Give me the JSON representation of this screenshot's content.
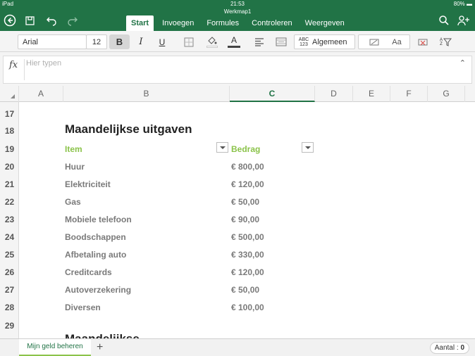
{
  "status_bar": {
    "carrier": "iPad",
    "time": "21:53",
    "battery": "80%"
  },
  "document": {
    "title": "Werkmap1"
  },
  "ribbon": {
    "tabs": [
      {
        "label": "Start"
      },
      {
        "label": "Invoegen"
      },
      {
        "label": "Formules"
      },
      {
        "label": "Controleren"
      },
      {
        "label": "Weergeven"
      }
    ]
  },
  "toolbar": {
    "font_name": "Arial",
    "font_size": "12",
    "bold_label": "B",
    "italic_label": "I",
    "underline_label": "U",
    "number_format_label": "Algemeen",
    "number_format_icon_text": "ABC 123",
    "styles_label": "Aa",
    "sort_icon_text": "A Z"
  },
  "formula_bar": {
    "fx_label": "fx",
    "placeholder": "Hier typen"
  },
  "columns": [
    "A",
    "B",
    "C",
    "D",
    "E",
    "F",
    "G"
  ],
  "selected_column": "C",
  "rows": [
    "17",
    "18",
    "19",
    "20",
    "21",
    "22",
    "23",
    "24",
    "25",
    "26",
    "27",
    "28",
    "29"
  ],
  "sheet": {
    "title": "Maandelijkse uitgaven",
    "headers": {
      "item": "Item",
      "amount": "Bedrag"
    },
    "entries": [
      {
        "item": "Huur",
        "amount": "€ 800,00"
      },
      {
        "item": "Elektriciteit",
        "amount": "€ 120,00"
      },
      {
        "item": "Gas",
        "amount": "€ 50,00"
      },
      {
        "item": "Mobiele telefoon",
        "amount": "€ 90,00"
      },
      {
        "item": "Boodschappen",
        "amount": "€ 500,00"
      },
      {
        "item": "Afbetaling auto",
        "amount": "€ 330,00"
      },
      {
        "item": "Creditcards",
        "amount": "€ 120,00"
      },
      {
        "item": "Autoverzekering",
        "amount": "€ 50,00"
      },
      {
        "item": "Diversen",
        "amount": "€ 100,00"
      }
    ],
    "next_title_partial": "Maandelijkse..."
  },
  "bottom": {
    "sheet_tab": "Mijn geld beheren",
    "add_sheet": "+",
    "count_label": "Aantal :",
    "count_value": "0"
  },
  "colors": {
    "brand": "#217346",
    "header_green": "#8bc34a"
  },
  "icons": [
    "back-icon",
    "save-icon",
    "undo-icon",
    "redo-icon",
    "search-icon",
    "share-person-icon",
    "borders-icon",
    "fill-color-icon",
    "font-color-icon",
    "align-icon",
    "merge-wrap-icon",
    "cell-style-icon",
    "delete-cells-icon",
    "sort-filter-icon",
    "collapse-chevron-icon",
    "filter-dropdown-icon"
  ]
}
